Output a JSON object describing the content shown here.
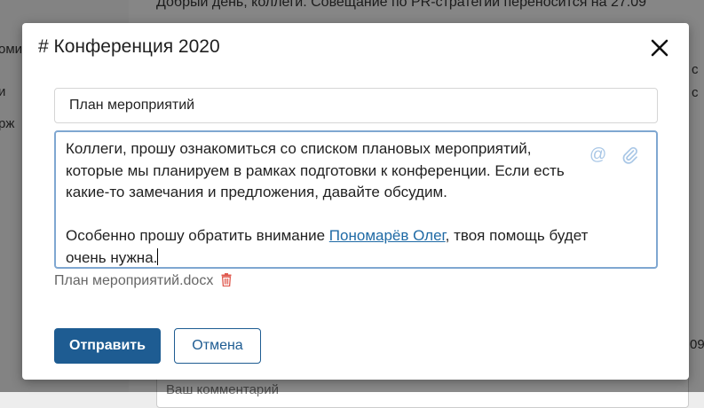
{
  "background": {
    "sidebar_fragments": [
      "оми",
      "и",
      "рж"
    ],
    "notice": "Добрый день, коллеги. Совещание по PR-стратегии переносится на 27.09",
    "right_fragments": [
      "с",
      "с",
      "09"
    ],
    "comment_placeholder": "Ваш комментарий"
  },
  "modal": {
    "title": "# Конференция 2020",
    "subject_value": "План мероприятий",
    "message": {
      "line1": "Коллеги, прошу ознакомиться со списком плановых мероприятий, которые мы планируем в рамках подготовки к конференции. Если есть какие-то замечания и предложения, давайте обсудим.",
      "line2_before": "Особенно прошу обратить внимание ",
      "mention": "Пономарёв Олег",
      "line2_after": ", твоя помощь будет очень нужна."
    },
    "attachment_name": "План мероприятий.docx",
    "send_label": "Отправить",
    "cancel_label": "Отмена",
    "icons": {
      "close": "close-icon",
      "mention": "at-icon",
      "attach": "paperclip-icon",
      "delete": "trash-icon"
    },
    "colors": {
      "primary": "#1e5c92",
      "link": "#1f6aa5",
      "delete": "#e05a4f",
      "editor_border": "#7fa7d1"
    }
  }
}
